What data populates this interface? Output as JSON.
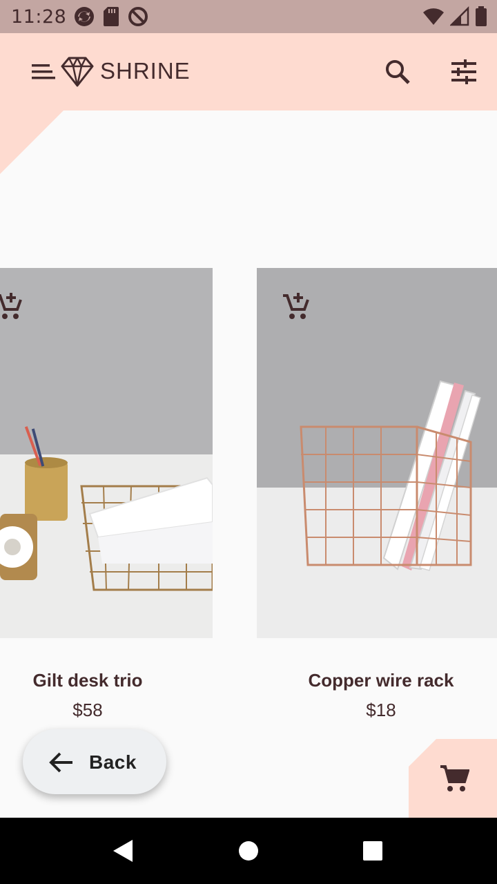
{
  "status_bar": {
    "time": "11:28",
    "left_icons": [
      "sync-icon",
      "sd-card-icon",
      "do-not-disturb-icon"
    ],
    "right_icons": [
      "wifi-icon",
      "cellular-signal-icon",
      "battery-icon"
    ]
  },
  "app_bar": {
    "title": "SHRINE",
    "menu_icon": "menu-icon",
    "logo_icon": "diamond-logo-icon",
    "actions": [
      "search-icon",
      "tune-icon"
    ]
  },
  "products": [
    {
      "name": "Gilt desk trio",
      "price": "$58",
      "action_icon": "add-shopping-cart-icon"
    },
    {
      "name": "Copper wire rack",
      "price": "$18",
      "action_icon": "add-shopping-cart-icon"
    }
  ],
  "back_button": {
    "label": "Back",
    "icon": "arrow-back-icon"
  },
  "cart_fab": {
    "icon": "shopping-cart-icon"
  },
  "nav_bar": {
    "buttons": [
      "nav-back-icon",
      "nav-home-icon",
      "nav-recents-icon"
    ]
  },
  "colors": {
    "status_bar": "#c3a6a2",
    "app_bar": "#fedbd0",
    "surface": "#fafafa",
    "text": "#442b2d",
    "back_button": "#eef0f2"
  }
}
